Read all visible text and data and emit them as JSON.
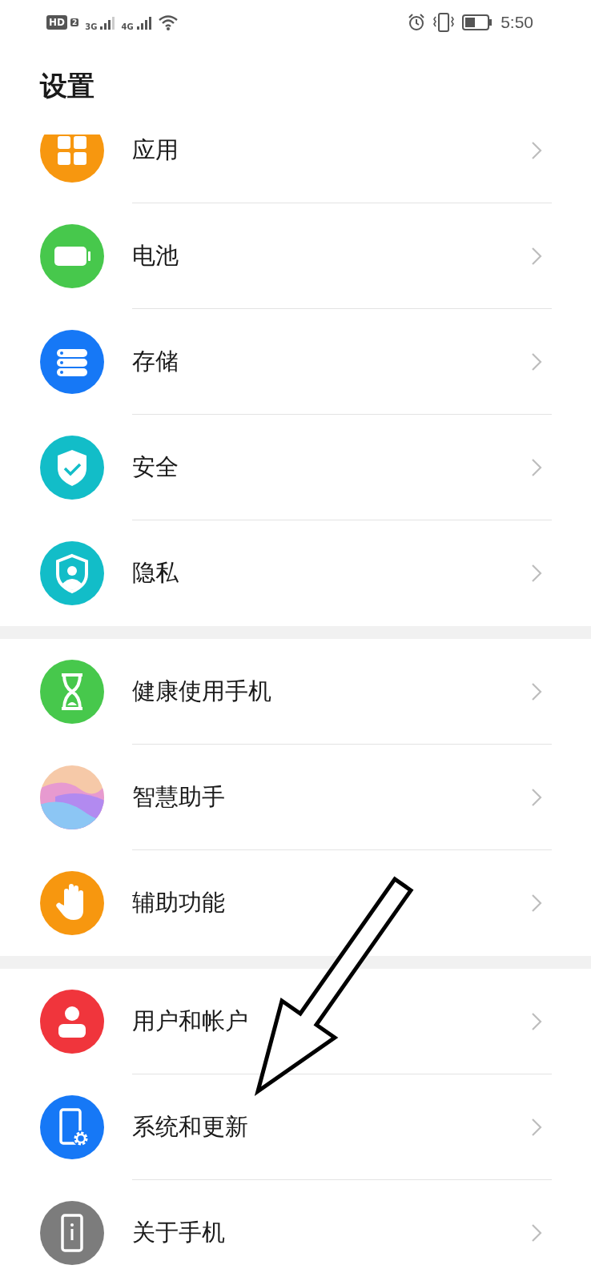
{
  "status_bar": {
    "hd": "HD",
    "sim": "2",
    "network_1": "3G",
    "network_2": "4G",
    "time": "5:50"
  },
  "title": "设置",
  "groups": [
    {
      "items": [
        {
          "label": "应用",
          "kind": "apps"
        },
        {
          "label": "电池",
          "kind": "battery"
        },
        {
          "label": "存储",
          "kind": "storage"
        },
        {
          "label": "安全",
          "kind": "security"
        },
        {
          "label": "隐私",
          "kind": "privacy"
        }
      ]
    },
    {
      "items": [
        {
          "label": "健康使用手机",
          "kind": "hourglass"
        },
        {
          "label": "智慧助手",
          "kind": "assistant"
        },
        {
          "label": "辅助功能",
          "kind": "hand"
        }
      ]
    },
    {
      "items": [
        {
          "label": "用户和帐户",
          "kind": "user"
        },
        {
          "label": "系统和更新",
          "kind": "system"
        },
        {
          "label": "关于手机",
          "kind": "about"
        }
      ]
    }
  ],
  "annotation": {
    "kind": "arrow"
  }
}
